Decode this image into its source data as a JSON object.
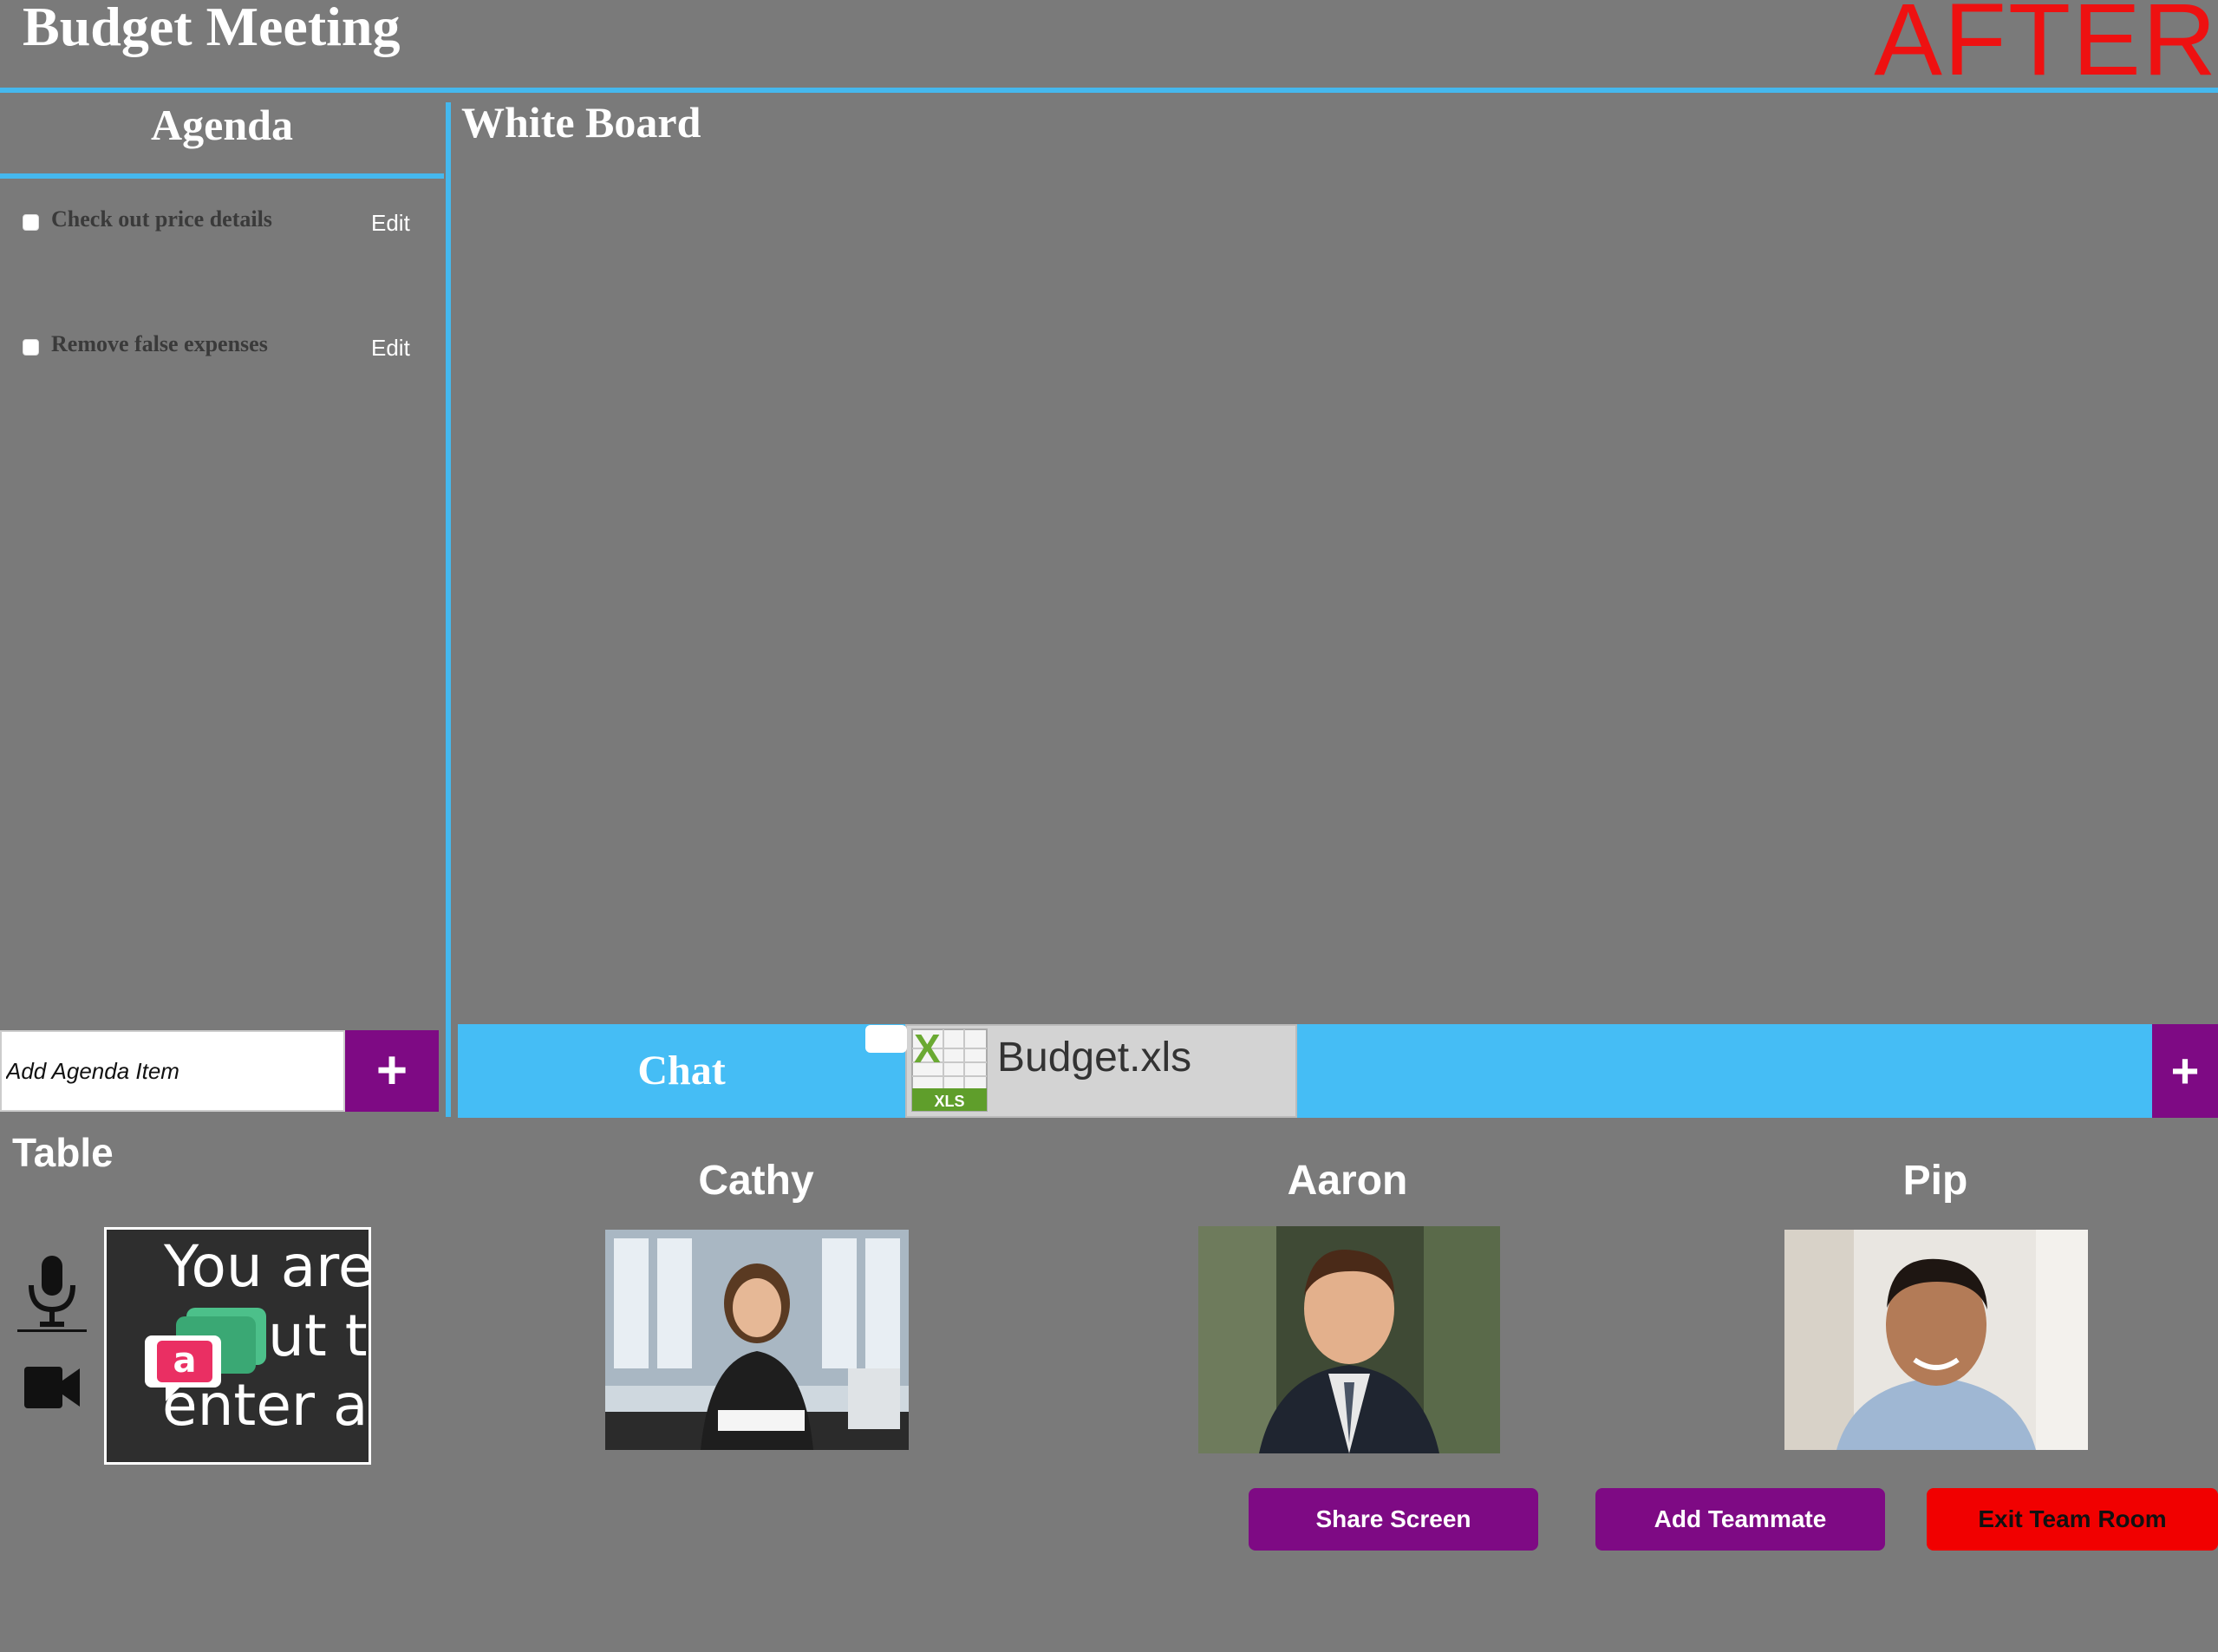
{
  "header": {
    "title": "Budget Meeting",
    "tag": "AFTER"
  },
  "agenda": {
    "title": "Agenda",
    "items": [
      {
        "label": "Check out price details",
        "edit_label": "Edit",
        "checked": false
      },
      {
        "label": "Remove false expenses",
        "edit_label": "Edit",
        "checked": false
      }
    ],
    "add_placeholder": "Add Agenda Item",
    "add_button": "+"
  },
  "whiteboard": {
    "title": "White Board"
  },
  "chatbar": {
    "chat_label": "Chat",
    "file_name": "Budget.xls",
    "file_type": "XLS",
    "add_button": "+"
  },
  "table": {
    "label": "Table",
    "self_video_lines": [
      "You are",
      "ut to",
      "enter an"
    ],
    "participants": [
      {
        "name": "Cathy"
      },
      {
        "name": "Aaron"
      },
      {
        "name": "Pip"
      }
    ]
  },
  "actions": {
    "share_screen": "Share Screen",
    "add_teammate": "Add Teammate",
    "exit_room": "Exit Team Room"
  },
  "colors": {
    "accent_blue": "#45bdf5",
    "purple": "#7e0a84",
    "exit_red": "#f10000",
    "background": "#7a7a7a"
  }
}
